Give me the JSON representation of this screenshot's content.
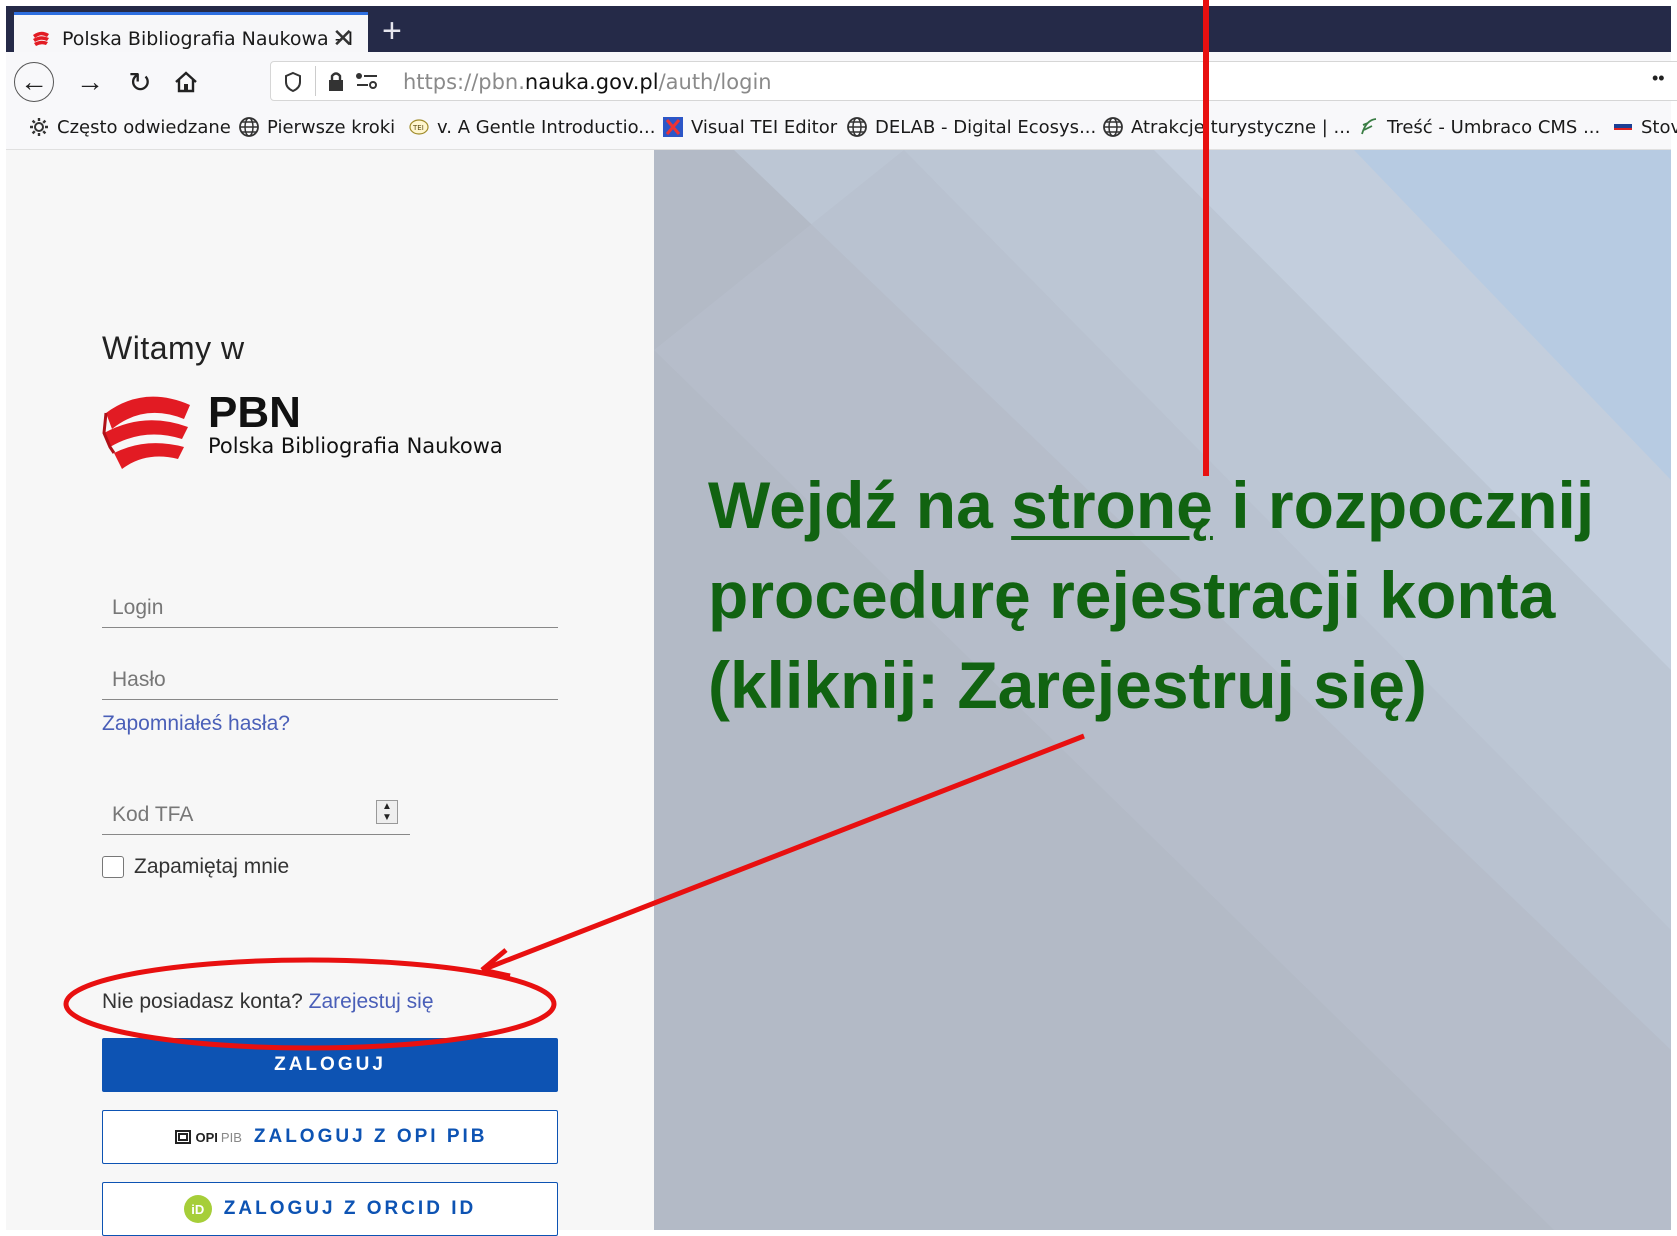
{
  "browser": {
    "tab_title": "Polska Bibliografia Naukowa - I",
    "new_tab_label": "+",
    "url_prefix": "https://pbn.",
    "url_domain": "nauka.gov.pl",
    "url_path": "/auth/login",
    "more": "••",
    "bookmarks": [
      {
        "label": "Często odwiedzane",
        "icon": "gear-icon"
      },
      {
        "label": "Pierwsze kroki",
        "icon": "globe-icon"
      },
      {
        "label": "v. A Gentle Introductio...",
        "icon": "tei-icon"
      },
      {
        "label": "Visual TEI Editor",
        "icon": "x-logo-icon"
      },
      {
        "label": "DELAB - Digital Ecosys...",
        "icon": "globe-icon"
      },
      {
        "label": "Atrakcje turystyczne | ...",
        "icon": "globe-icon"
      },
      {
        "label": "Treść - Umbraco CMS ...",
        "icon": "umbraco-icon"
      },
      {
        "label": "Stov",
        "icon": "flag-icon"
      }
    ]
  },
  "login": {
    "welcome": "Witamy w",
    "logo_name": "PBN",
    "logo_subtitle": "Polska Bibliografia Naukowa",
    "login_placeholder": "Login",
    "password_placeholder": "Hasło",
    "forgot_password": "Zapomniałeś hasła?",
    "tfa_placeholder": "Kod TFA",
    "remember_me": "Zapamiętaj mnie",
    "no_account": "Nie posiadasz konta?",
    "register": "Zarejestuj się",
    "login_button": "ZALOGUJ",
    "opi_button": "ZALOGUJ Z OPI PIB",
    "opi_logo": "OPI",
    "opi_logo_pib": "PIB",
    "orcid_button": "ZALOGUJ Z ORCID ID",
    "orcid_logo": "iD"
  },
  "annotation": {
    "part1": "Wejdź na ",
    "link": "stronę",
    "part2": " i rozpocznij procedurę rejestracji konta (kliknij: Zarejestruj się)",
    "color": "#116311",
    "marker_color": "#e81010"
  },
  "colors": {
    "primary": "#0d53b3",
    "link": "#4a5fb8",
    "tabbar": "#252a48"
  }
}
